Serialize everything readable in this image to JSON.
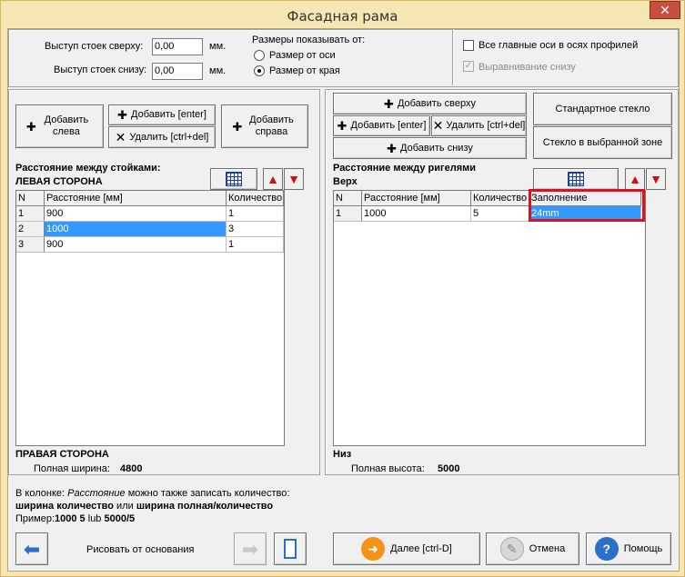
{
  "window": {
    "title": "Фасадная рама",
    "close": "✕"
  },
  "top": {
    "offset_top_label": "Выступ стоек сверху:",
    "offset_top_value": "0,00",
    "offset_bottom_label": "Выступ стоек снизу:",
    "offset_bottom_value": "0,00",
    "unit": "мм.",
    "show_label": "Размеры показывать от:",
    "radio_axis": "Размер от оси",
    "radio_edge": "Размер от края",
    "check_axes": "Все главные оси в осях профилей",
    "check_align": "Выравнивание снизу"
  },
  "left": {
    "add_left": "Добавить слева",
    "add_enter": "Добавить [enter]",
    "delete": "Удалить [ctrl+del]",
    "add_right": "Добавить справа",
    "heading": "Расстояние между стойками:",
    "side": "ЛЕВАЯ СТОРОНА",
    "columns": [
      "N",
      "Расстояние [мм]",
      "Количество"
    ],
    "rows": [
      {
        "n": "1",
        "dist": "900",
        "qty": "1"
      },
      {
        "n": "2",
        "dist": "1000",
        "qty": "3"
      },
      {
        "n": "3",
        "dist": "900",
        "qty": "1"
      }
    ],
    "bottom_side": "ПРАВАЯ СТОРОНА",
    "total_label": "Полная ширина:",
    "total_value": "4800"
  },
  "right": {
    "add_top": "Добавить сверху",
    "add_enter": "Добавить [enter]",
    "delete": "Удалить [ctrl+del]",
    "add_bottom": "Добавить снизу",
    "std_glass": "Стандартное стекло",
    "zone_glass": "Стекло в выбранной зоне",
    "heading": "Расстояние между ригелями",
    "side": "Верх",
    "columns": [
      "N",
      "Расстояние [мм]",
      "Количество",
      "Заполнение"
    ],
    "rows": [
      {
        "n": "1",
        "dist": "1000",
        "qty": "5",
        "fill": "24mm"
      }
    ],
    "bottom_side": "Низ",
    "total_label": "Полная высота:",
    "total_value": "5000"
  },
  "hint": {
    "line1_a": "В колонке: ",
    "line1_b": "Расстояние",
    "line1_c": " можно также записать количество:",
    "line2_a": "ширина количество",
    "line2_b": " или ",
    "line2_c": "ширина полная/количество",
    "line3_a": "Пример:",
    "line3_b": "1000 5",
    "line3_c": "  lub ",
    "line3_d": "5000/5"
  },
  "footer": {
    "draw_label": "Рисовать от основания",
    "next": "Далее [ctrl-D]",
    "cancel": "Отмена",
    "help": "Помощь"
  },
  "colors": {
    "selection": "#3399ff",
    "highlight_border": "#e0101a",
    "arrow_red": "#d01010",
    "blue_arrow": "#2a6fc9"
  }
}
